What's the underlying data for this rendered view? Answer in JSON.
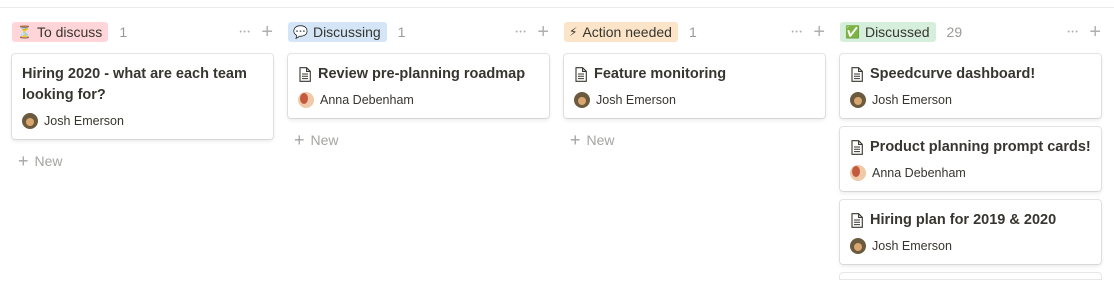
{
  "columns": [
    {
      "emoji": "⏳",
      "label": "To discuss",
      "tag_color": "#ffd5d9",
      "count": "1",
      "cards": [
        {
          "title": "Hiring 2020 - what are each team looking for?",
          "person": "Josh Emerson",
          "avatar": "josh",
          "show_doc_icon": false
        }
      ],
      "new_label": "New"
    },
    {
      "emoji": "💬",
      "label": "Discussing",
      "tag_color": "#d3e5f7",
      "count": "1",
      "cards": [
        {
          "title": "Review pre-planning roadmap",
          "person": "Anna Debenham",
          "avatar": "anna",
          "show_doc_icon": true
        }
      ],
      "new_label": "New"
    },
    {
      "emoji": "⚡",
      "label": "Action needed",
      "tag_color": "#fbe4c7",
      "count": "1",
      "cards": [
        {
          "title": "Feature monitoring",
          "person": "Josh Emerson",
          "avatar": "josh",
          "show_doc_icon": true
        }
      ],
      "new_label": "New"
    },
    {
      "emoji": "✅",
      "label": "Discussed",
      "tag_color": "#d6eedc",
      "count": "29",
      "cards": [
        {
          "title": "Speedcurve dashboard!",
          "person": "Josh Emerson",
          "avatar": "josh",
          "show_doc_icon": true
        },
        {
          "title": "Product planning prompt cards!",
          "person": "Anna Debenham",
          "avatar": "anna",
          "show_doc_icon": true
        },
        {
          "title": "Hiring plan for 2019 & 2020",
          "person": "Josh Emerson",
          "avatar": "josh",
          "show_doc_icon": true
        }
      ],
      "new_label": ""
    }
  ],
  "icons": {
    "more": "more-dots-icon",
    "add": "plus-icon",
    "doc": "page-icon"
  }
}
